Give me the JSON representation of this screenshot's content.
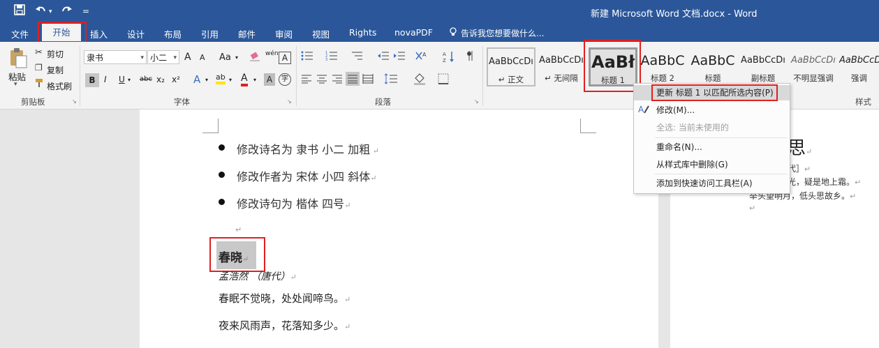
{
  "window": {
    "title": "新建 Microsoft Word 文档.docx - Word"
  },
  "quick_access": {
    "save_icon": "save-icon",
    "undo_icon": "undo-icon",
    "redo_icon": "redo-icon",
    "customize": "="
  },
  "tabs": [
    "文件",
    "开始",
    "插入",
    "设计",
    "布局",
    "引用",
    "邮件",
    "审阅",
    "视图",
    "Rights",
    "novaPDF"
  ],
  "tell_me": "告诉我您想要做什么...",
  "clipboard": {
    "paste": "粘贴",
    "cut": "剪切",
    "copy": "复制",
    "format_painter": "格式刷",
    "label": "剪贴板"
  },
  "font": {
    "name": "隶书",
    "size": "小二",
    "label": "字体",
    "grow": "A",
    "shrink": "A",
    "case": "Aa",
    "phonetic": "wén",
    "border_char": "A",
    "bold": "B",
    "italic": "I",
    "underline": "U",
    "strike": "abc",
    "sub": "x₂",
    "sup": "x²",
    "effects": "A",
    "highlight": "ab",
    "color": "A",
    "shade": "A",
    "enclose": "字"
  },
  "paragraph": {
    "label": "段落"
  },
  "styles": {
    "label": "样式",
    "items": [
      {
        "sample": "AaBbCcDı",
        "name": "↵ 正文"
      },
      {
        "sample": "AaBbCcDı",
        "name": "↵ 无间隔"
      },
      {
        "sample": "AaBł",
        "name": "标题 1"
      },
      {
        "sample": "AaBbC",
        "name": "标题 2"
      },
      {
        "sample": "AaBbC",
        "name": "标题"
      },
      {
        "sample": "AaBbCcDı",
        "name": "副标题"
      },
      {
        "sample": "AaBbCcDı",
        "name": "不明显强调"
      },
      {
        "sample": "AaBbCcDı",
        "name": "强调"
      }
    ]
  },
  "context_menu": {
    "items": [
      {
        "label": "更新 标题 1 以匹配所选内容(P)",
        "enabled": true
      },
      {
        "label": "修改(M)...",
        "enabled": true
      },
      {
        "label": "全选: 当前未使用的",
        "enabled": false
      },
      {
        "label": "重命名(N)...",
        "enabled": true
      },
      {
        "label": "从样式库中删除(G)",
        "enabled": true
      },
      {
        "label": "添加到快速访问工具栏(A)",
        "enabled": true
      }
    ]
  },
  "document": {
    "bullets": [
      "修改诗名为 隶书 小二 加粗",
      "修改作者为 宋体 小四 斜体",
      "修改诗句为 楷体 四号"
    ],
    "poem_title": "春晓",
    "author": "孟浩然 （唐代）",
    "lines": [
      "春眠不觉晓，处处闻啼鸟。",
      "夜来风雨声，花落知多少。"
    ]
  },
  "second_page": {
    "title_fragment": "思",
    "author_fragment": "代］",
    "line1": "光，疑是地上霜。",
    "line2": "举头望明月，低头思故乡。"
  },
  "colors": {
    "accent": "#2b579a",
    "highlight_box": "#e02020"
  }
}
